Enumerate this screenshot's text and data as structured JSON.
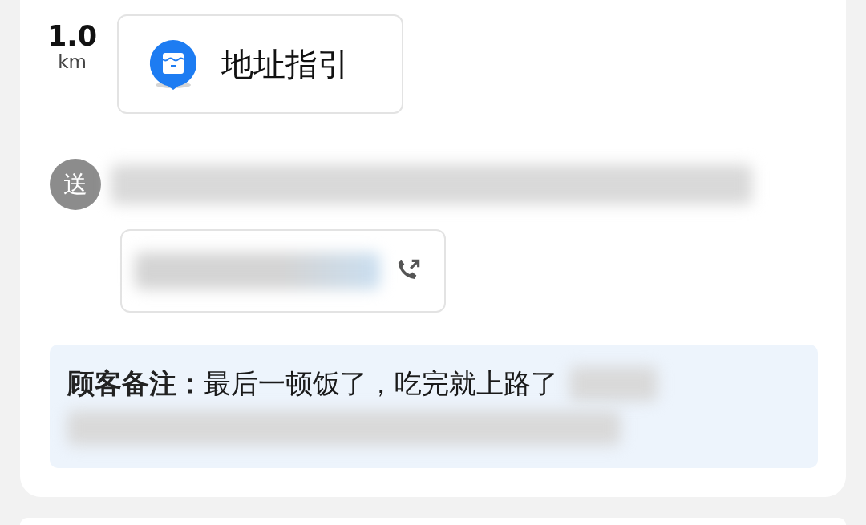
{
  "distance": {
    "value": "1.0",
    "unit": "km"
  },
  "guide_button": {
    "label": "地址指引"
  },
  "delivery": {
    "badge": "送",
    "address_blurred": true
  },
  "phone": {
    "number_blurred": true
  },
  "note": {
    "text": "**顾客备注：**最后一顿饭了，吃完就上路了",
    "tail_blurred": true
  }
}
